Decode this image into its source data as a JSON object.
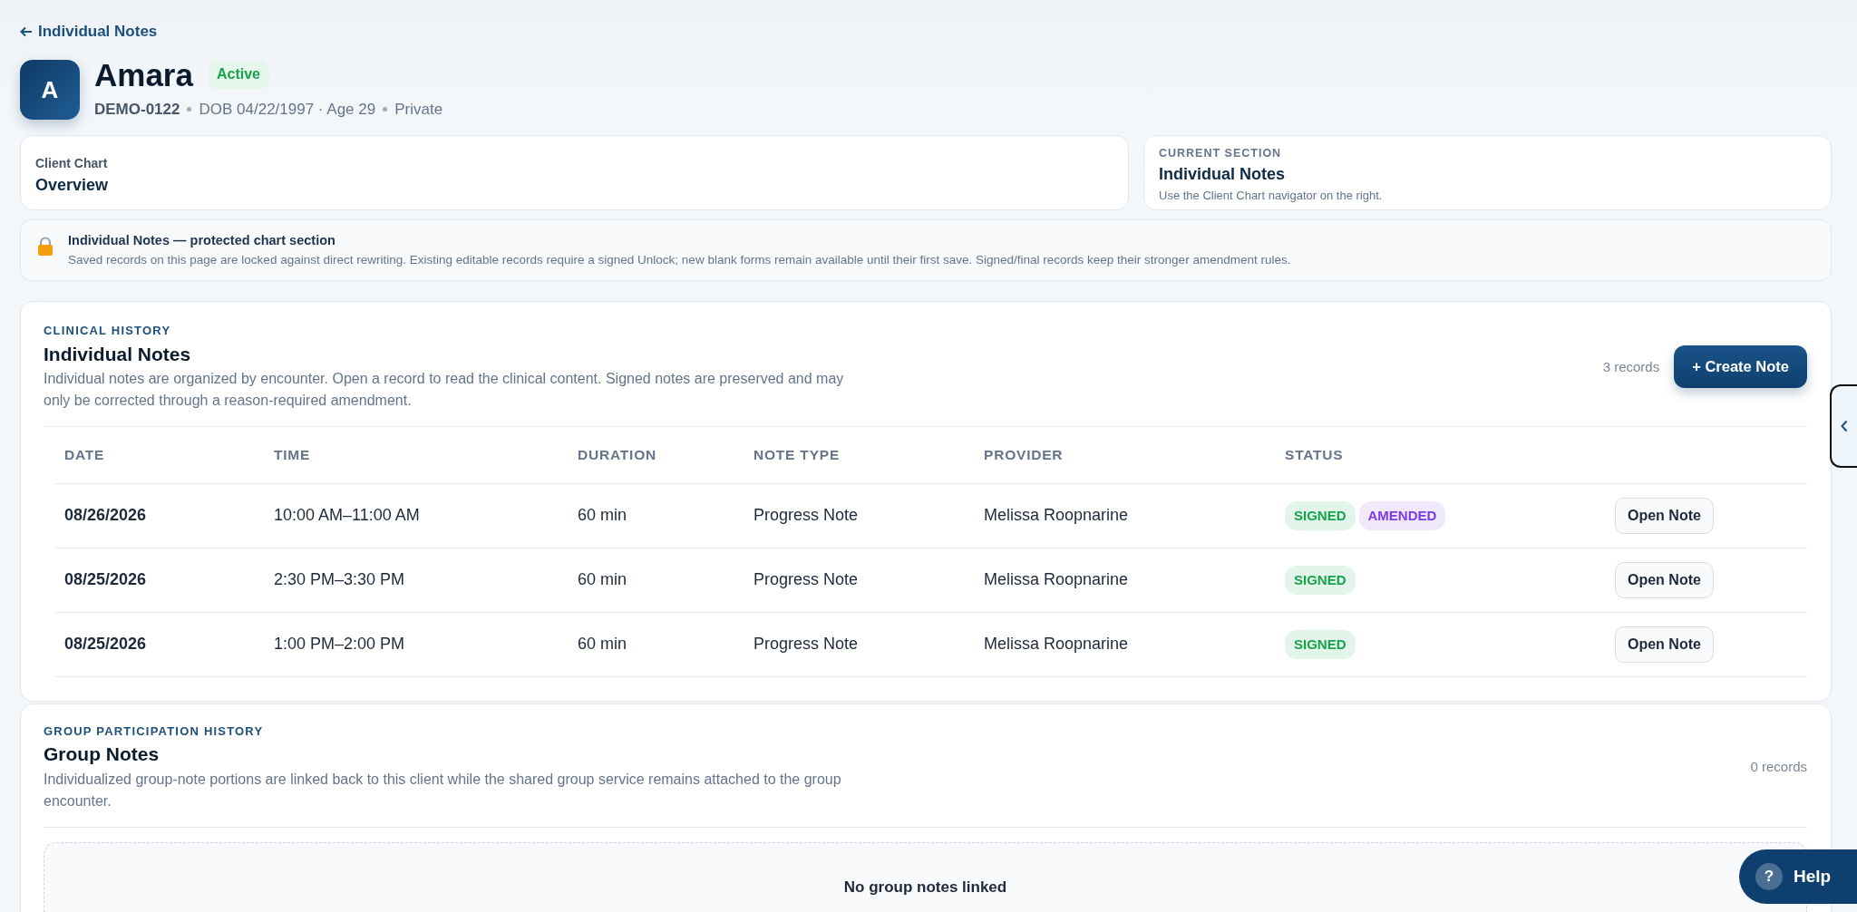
{
  "back_link": {
    "label": "Individual Notes"
  },
  "client": {
    "initial": "A",
    "name": "Amara",
    "status": "Active",
    "id": "DEMO-0122",
    "details": [
      "DOB 04/22/1997 · Age 29",
      "Private"
    ]
  },
  "chart_card": {
    "label": "Client Chart",
    "value": "Overview"
  },
  "current_section": {
    "label": "CURRENT SECTION",
    "title": "Individual Notes",
    "hint": "Use the Client Chart navigator on the right."
  },
  "notice": {
    "title": "Individual Notes — protected chart section",
    "text": "Saved records on this page are locked against direct rewriting. Existing editable records require a signed Unlock; new blank forms remain available until their first save. Signed/final records keep their stronger amendment rules."
  },
  "individual_notes": {
    "eyebrow": "CLINICAL HISTORY",
    "title": "Individual Notes",
    "description": "Individual notes are organized by encounter. Open a record to read the clinical content. Signed notes are preserved and may only be corrected through a reason-required amendment.",
    "count": "3 records",
    "create_button": "+ Create Note",
    "columns": [
      "DATE",
      "TIME",
      "DURATION",
      "NOTE TYPE",
      "PROVIDER",
      "STATUS"
    ],
    "rows": [
      {
        "date": "08/26/2026",
        "time": "10:00 AM–11:00 AM",
        "duration": "60 min",
        "note_type": "Progress Note",
        "provider": "Melissa Roopnarine",
        "statuses": [
          {
            "label": "SIGNED",
            "kind": "signed"
          },
          {
            "label": "AMENDED",
            "kind": "amended"
          }
        ],
        "action": "Open Note"
      },
      {
        "date": "08/25/2026",
        "time": "2:30 PM–3:30 PM",
        "duration": "60 min",
        "note_type": "Progress Note",
        "provider": "Melissa Roopnarine",
        "statuses": [
          {
            "label": "SIGNED",
            "kind": "signed"
          }
        ],
        "action": "Open Note"
      },
      {
        "date": "08/25/2026",
        "time": "1:00 PM–2:00 PM",
        "duration": "60 min",
        "note_type": "Progress Note",
        "provider": "Melissa Roopnarine",
        "statuses": [
          {
            "label": "SIGNED",
            "kind": "signed"
          }
        ],
        "action": "Open Note"
      }
    ]
  },
  "group_notes": {
    "eyebrow": "GROUP PARTICIPATION HISTORY",
    "title": "Group Notes",
    "description": "Individualized group-note portions are linked back to this client while the shared group service remains attached to the group encounter.",
    "count": "0 records",
    "empty_title": "No group notes linked"
  },
  "help_button": {
    "label": "Help",
    "icon_text": "?"
  }
}
